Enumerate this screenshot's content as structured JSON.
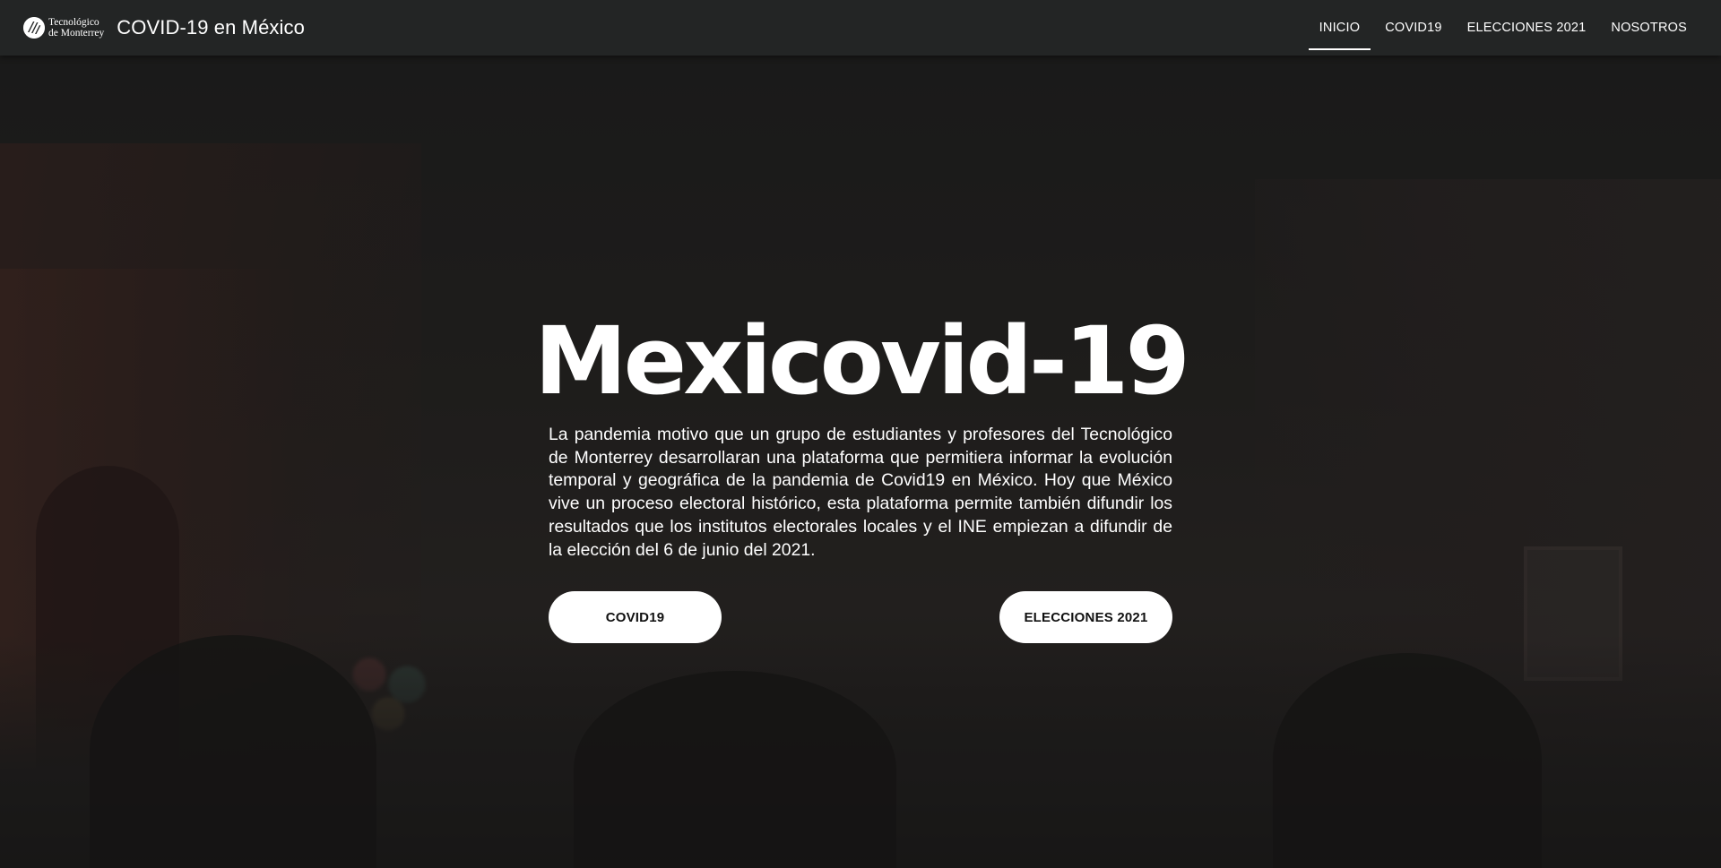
{
  "brand": {
    "logo_line1": "Tecnológico",
    "logo_line2": "de Monterrey",
    "site_title": "COVID-19 en México"
  },
  "nav": {
    "items": [
      {
        "label": "INICIO",
        "active": true
      },
      {
        "label": "COVID19",
        "active": false
      },
      {
        "label": "ELECCIONES 2021",
        "active": false
      },
      {
        "label": "NOSOTROS",
        "active": false
      }
    ]
  },
  "hero": {
    "title": "Mexicovid-19",
    "description": "La pandemia motivo que un grupo de estudiantes y profesores del Tecnológico de Monterrey desarrollaran una plataforma que permitiera informar la evolución temporal y geográfica de la pandemia de Covid19 en México. Hoy que México vive un proceso electoral histórico, esta plataforma permite también difundir los resultados que los institutos electorales locales y el INE empiezan a difundir de la elección del 6 de junio del 2021.",
    "buttons": {
      "covid_label": "COVID19",
      "elecciones_label": "ELECCIONES 2021"
    }
  },
  "colors": {
    "navbar_bg": "#232525",
    "text": "#ffffff",
    "button_bg": "#ffffff",
    "button_text": "#111111"
  }
}
